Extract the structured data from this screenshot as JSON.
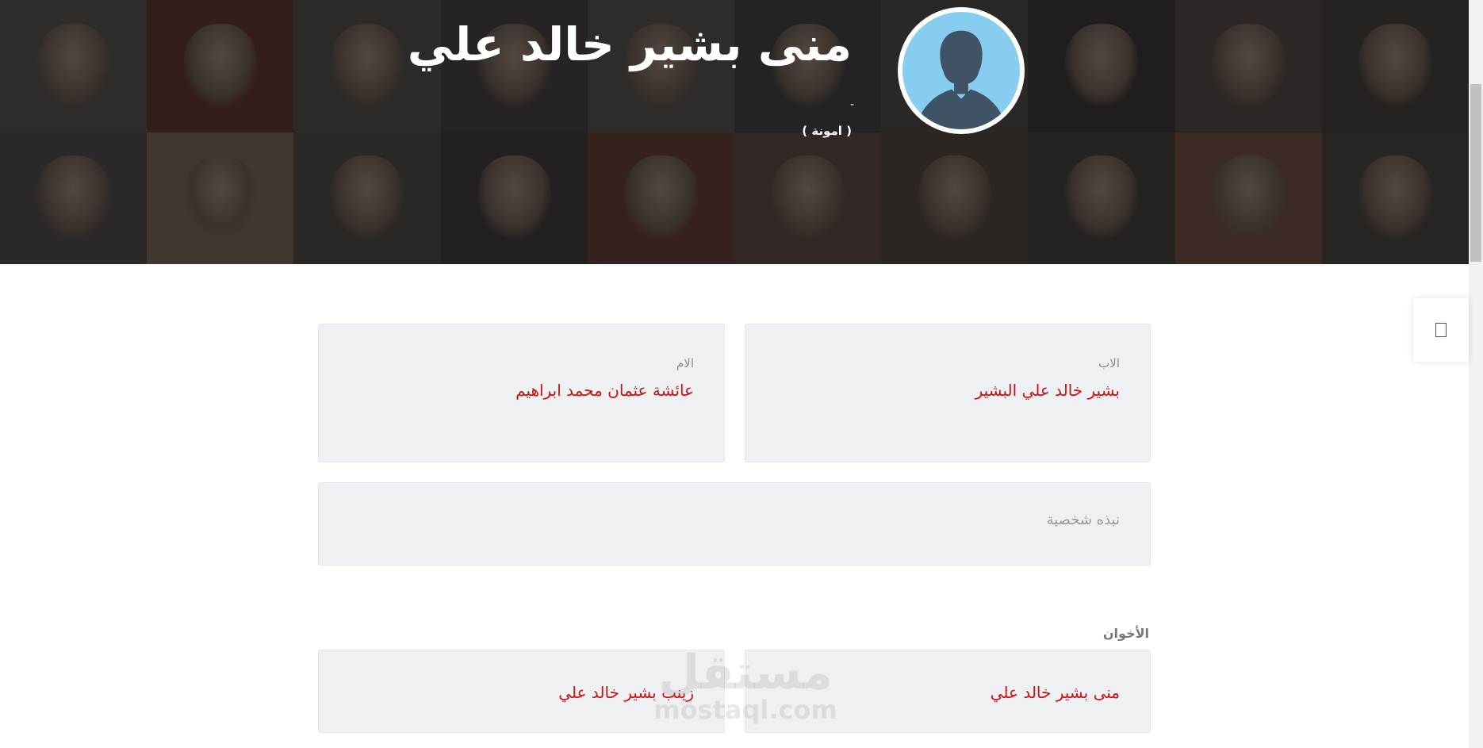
{
  "hero": {
    "name": "منى بشير خالد علي",
    "dash": "-",
    "nickname": "( امونة )"
  },
  "parents": {
    "father_label": "الاب",
    "father_name": "بشير خالد علي البشير",
    "mother_label": "الام",
    "mother_name": "عائشة عثمان محمد ابراهيم"
  },
  "bio": {
    "label": "نبذه شخصية"
  },
  "siblings": {
    "title": "الأخوان",
    "items": [
      {
        "name": "منى بشير خالد علي"
      },
      {
        "name": "زينب بشير خالد علي"
      }
    ]
  },
  "watermark": {
    "arabic": "مستقل",
    "latin": "mostaql.com"
  },
  "icons": {
    "avatar": "person-silhouette-icon",
    "side_tab": "page-icon"
  },
  "colors": {
    "accent": "#cc1111",
    "card_bg": "#eef0f3",
    "avatar_bg": "#87cdf0"
  }
}
